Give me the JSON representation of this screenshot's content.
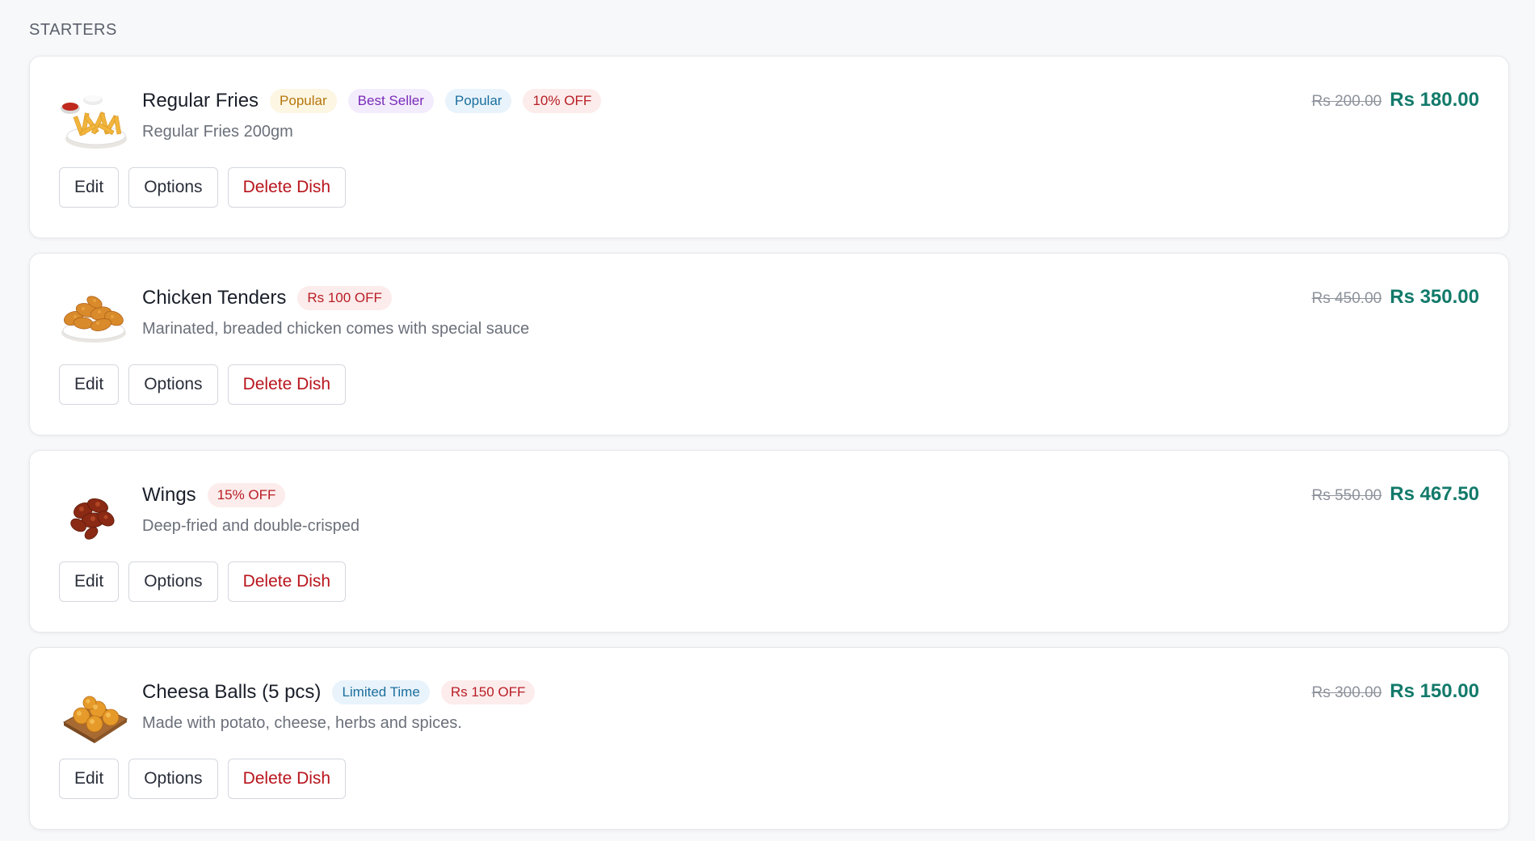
{
  "section": {
    "title": "STARTERS"
  },
  "dishes": [
    {
      "name": "Regular Fries",
      "description": "Regular Fries 200gm",
      "image_icon": "fries-image",
      "badges": [
        {
          "label": "Popular",
          "color": "yellow"
        },
        {
          "label": "Best Seller",
          "color": "purple"
        },
        {
          "label": "Popular",
          "color": "blue"
        },
        {
          "label": "10% OFF",
          "color": "red"
        }
      ],
      "old_price": "Rs 200.00",
      "new_price": "Rs 180.00",
      "actions": {
        "edit": "Edit",
        "options": "Options",
        "delete": "Delete Dish"
      }
    },
    {
      "name": "Chicken Tenders",
      "description": "Marinated, breaded chicken comes with special sauce",
      "image_icon": "chicken-tenders-image",
      "badges": [
        {
          "label": "Rs 100 OFF",
          "color": "red"
        }
      ],
      "old_price": "Rs 450.00",
      "new_price": "Rs 350.00",
      "actions": {
        "edit": "Edit",
        "options": "Options",
        "delete": "Delete Dish"
      }
    },
    {
      "name": "Wings",
      "description": "Deep-fried and double-crisped",
      "image_icon": "wings-image",
      "badges": [
        {
          "label": "15% OFF",
          "color": "red"
        }
      ],
      "old_price": "Rs 550.00",
      "new_price": "Rs 467.50",
      "actions": {
        "edit": "Edit",
        "options": "Options",
        "delete": "Delete Dish"
      }
    },
    {
      "name": "Cheesa Balls (5 pcs)",
      "description": "Made with potato, cheese, herbs and spices.",
      "image_icon": "cheese-balls-image",
      "badges": [
        {
          "label": "Limited Time",
          "color": "blue"
        },
        {
          "label": "Rs 150 OFF",
          "color": "red"
        }
      ],
      "old_price": "Rs 300.00",
      "new_price": "Rs 150.00",
      "actions": {
        "edit": "Edit",
        "options": "Options",
        "delete": "Delete Dish"
      }
    }
  ],
  "colors": {
    "price_accent": "#127a6a",
    "delete_text": "#b8141c",
    "badge_red_text": "#b81d24"
  }
}
